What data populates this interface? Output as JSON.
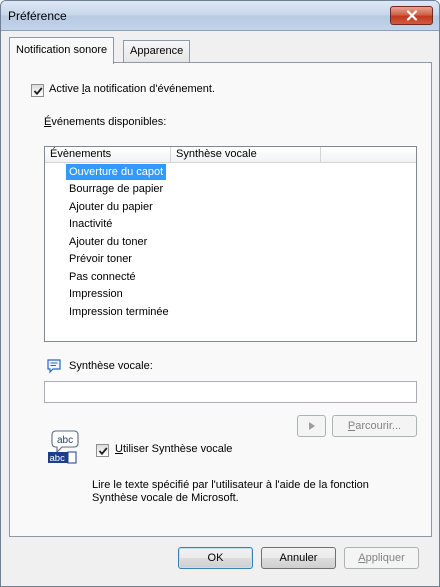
{
  "window": {
    "title": "Préférence"
  },
  "tabs": [
    {
      "label": "Notification sonore",
      "active": true
    },
    {
      "label": "Apparence",
      "active": false
    }
  ],
  "notification": {
    "enable_label_pre": "Active ",
    "enable_label_u": "l",
    "enable_label_post": "a notification d'événement.",
    "enable_checked": true
  },
  "events": {
    "label_u": "É",
    "label_rest": "vénements disponibles:",
    "columns": [
      "Évènements",
      "Synthèse vocale"
    ],
    "items": [
      "Ouverture du capot",
      "Bourrage de papier",
      "Ajouter du papier",
      "Inactivité",
      "Ajouter du toner",
      "Prévoir toner",
      "Pas connecté",
      "Impression",
      "Impression terminée"
    ],
    "selected_index": 0
  },
  "voice": {
    "label": "Synthèse vocale:",
    "text_value": "",
    "play_icon": "play-icon",
    "browse_u": "P",
    "browse_rest": "arcourir...",
    "use_u": "U",
    "use_rest": "tiliser Synthèse vocale",
    "use_checked": true,
    "description_line1": "Lire le texte spécifié par l'utilisateur à l'aide de la fonction",
    "description_line2": "Synthèse vocale de Microsoft.",
    "icon_text_top": "abc",
    "icon_text_bottom": "abc"
  },
  "footer": {
    "ok": "OK",
    "cancel": "Annuler",
    "apply_u": "A",
    "apply_rest": "ppliquer"
  },
  "colors": {
    "selection": "#3399ff",
    "close_button": "#c0391f"
  }
}
